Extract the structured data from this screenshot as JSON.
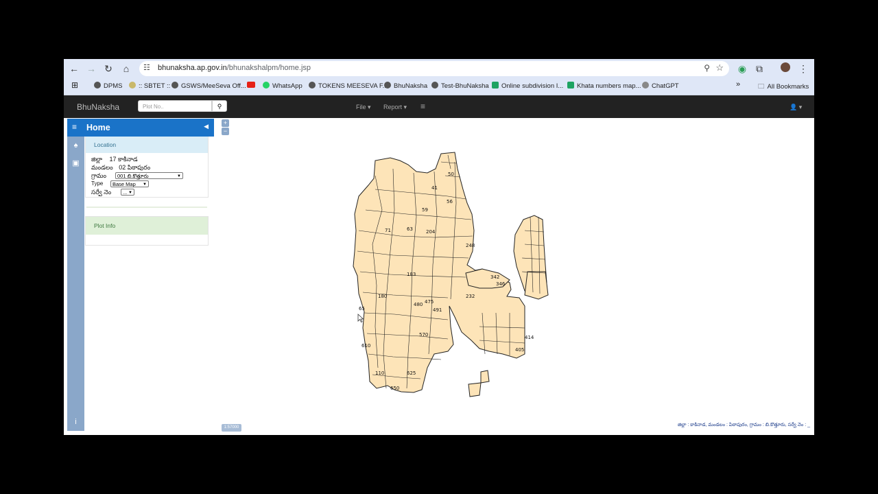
{
  "browser": {
    "url_domain": "bhunaksha.ap.gov.in",
    "url_path": "/bhunakshalpm/home.jsp",
    "bookmarks": [
      "DPMS",
      ":: SBTET ::",
      "GSWS/MeeSeva Off...",
      "WhatsApp",
      "TOKENS MEESEVA F...",
      "BhuNaksha",
      "Test-BhuNaksha",
      "Online subdivision I...",
      "Khata numbers map...",
      "ChatGPT"
    ],
    "all_bookmarks": "All Bookmarks",
    "overflow": "»"
  },
  "navbar": {
    "brand": "BhuNaksha",
    "search_placeholder": "Plot No..",
    "file_menu": "File ▾",
    "report_menu": "Report ▾",
    "list_menu": "≡",
    "user_menu": "👤 ▾"
  },
  "sidebar": {
    "home_title": "Home",
    "location_header": "Location",
    "district_label": "జిల్లా",
    "district_value": "17 కాకినాడ",
    "mandal_label": "మండలం",
    "mandal_value": "02 పిఠాపురం",
    "village_label": "గ్రామం",
    "village_value": "001 బి.కొత్తూరు",
    "type_label": "Type",
    "type_value": "Base Map",
    "survey_label": "సర్వే నెం",
    "survey_value": "...",
    "plot_info_header": "Plot Info"
  },
  "map": {
    "zoom_in": "+",
    "zoom_out": "−",
    "scale_label": "1:57000",
    "plot_labels": [
      "71",
      "63",
      "204",
      "56",
      "59",
      "50",
      "41",
      "248",
      "183",
      "475",
      "480",
      "491",
      "570",
      "610",
      "625",
      "650",
      "414",
      "405",
      "342",
      "346",
      "232",
      "180",
      "110",
      "65"
    ],
    "footer_info": "జిల్లా : కాకినాడ, మండలం : పిఠాపురం, గ్రామం : బి.కొత్తూరు, సర్వే నెం : _"
  },
  "colors": {
    "parcel_fill": "#fde4b8",
    "parcel_stroke": "#222222",
    "home_header": "#1a73c8",
    "side_strip": "#8aa7c9",
    "navbar": "#222222"
  }
}
